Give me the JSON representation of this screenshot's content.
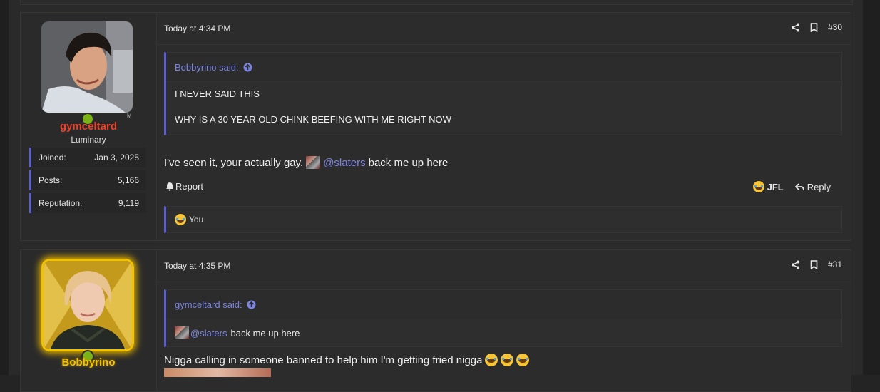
{
  "colors": {
    "accent": "#5b5fd0",
    "link": "#7c84e0",
    "username_red": "#f0402a",
    "username_gold": "#f5c400",
    "online": "#7ab318"
  },
  "post30": {
    "author": "gymceltard",
    "title": "Luminary",
    "stats": [
      {
        "label": "Joined:",
        "value": "Jan 3, 2025"
      },
      {
        "label": "Posts:",
        "value": "5,166"
      },
      {
        "label": "Reputation:",
        "value": "9,119"
      }
    ],
    "date": "Today at 4:34 PM",
    "number": "#30",
    "quote": {
      "author": "Bobbyrino said:",
      "lines": [
        "I NEVER SAID THIS",
        "WHY IS A 30 YEAR OLD CHINK BEEFING WITH ME RIGHT NOW"
      ]
    },
    "body_before": "I've seen it, your actually gay.",
    "mention": "@slaters",
    "body_after": "back me up here",
    "report_label": "Report",
    "reaction_label": "JFL",
    "reply_label": "Reply",
    "reacted_by": "You"
  },
  "post31": {
    "author": "Bobbyrino",
    "date": "Today at 4:35 PM",
    "number": "#31",
    "quote": {
      "author": "gymceltard said:",
      "mention": "@slaters",
      "text": "back me up here"
    },
    "body": "Nigga calling in someone banned to help him I'm getting fried nigga"
  }
}
